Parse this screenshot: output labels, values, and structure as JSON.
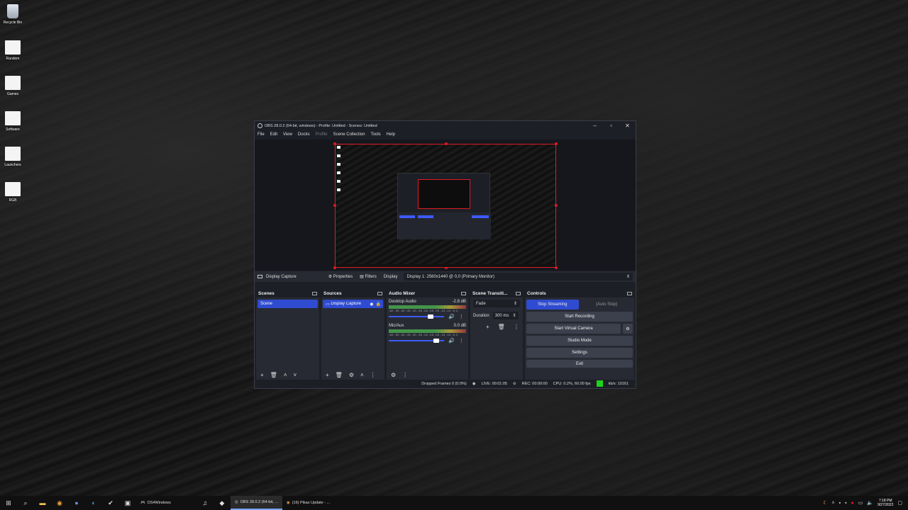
{
  "desktop": {
    "icons": [
      {
        "label": "Recycle Bin",
        "icon": "recycle-bin-icon"
      },
      {
        "label": "Random",
        "icon": "folder-icon"
      },
      {
        "label": "Games",
        "icon": "folder-icon"
      },
      {
        "label": "Software",
        "icon": "folder-icon"
      },
      {
        "label": "Launchers",
        "icon": "folder-icon"
      },
      {
        "label": "RGB",
        "icon": "folder-icon"
      }
    ]
  },
  "obs": {
    "title": "OBS 28.0.2 (64-bit, windows) - Profile: Untitled - Scenes: Untitled",
    "menu": [
      "File",
      "Edit",
      "View",
      "Docks",
      "Profile",
      "Scene Collection",
      "Tools",
      "Help"
    ],
    "source_bar": {
      "source_name": "Display Capture",
      "properties": "Properties",
      "filters": "Filters",
      "display_label": "Display",
      "display_value": "Display 1: 2560x1440 @ 0,0 (Primary Monitor)"
    },
    "docks": {
      "scenes": {
        "title": "Scenes",
        "items": [
          "Scene"
        ]
      },
      "sources": {
        "title": "Sources",
        "items": [
          "Display Capture"
        ]
      },
      "mixer": {
        "title": "Audio Mixer",
        "channels": [
          {
            "name": "Desktop Audio",
            "db": "-2.8 dB",
            "level": 0.78
          },
          {
            "name": "Mic/Aux",
            "db": "0.0 dB",
            "level": 0.9
          }
        ],
        "ticks": "-60 -55 -50 -45 -40 -35 -30 -25 -20 -15 -10 -5 0"
      },
      "transitions": {
        "title": "Scene Transiti...",
        "selected": "Fade",
        "duration_label": "Duration",
        "duration_value": "300 ms"
      },
      "controls": {
        "title": "Controls",
        "stop_streaming": "Stop Streaming",
        "auto_stop": "(Auto Stop)",
        "start_recording": "Start Recording",
        "start_virtual_camera": "Start Virtual Camera",
        "studio_mode": "Studio Mode",
        "settings": "Settings",
        "exit": "Exit"
      }
    },
    "status": {
      "dropped": "Dropped Frames 0 (0.0%)",
      "live": "LIVE: 00:01:05",
      "rec": "REC: 00:00:00",
      "cpu": "CPU: 0.2%, 60.00 fps",
      "kbps": "kb/s: 10161"
    }
  },
  "taskbar": {
    "apps": [
      {
        "label": "DS4Windows",
        "icon": "gamepad-icon"
      },
      {
        "label": "OBS 28.0.2 (64-bit, ...",
        "icon": "obs-icon"
      },
      {
        "label": "(16) Pikas Update - ...",
        "icon": "chrome-icon"
      }
    ],
    "time": "7:18 PM",
    "date": "9/27/2022"
  },
  "colors": {
    "accent": "#2f4bd1",
    "preview_border": "#e01b24",
    "live_indicator": "#1cd41c"
  }
}
